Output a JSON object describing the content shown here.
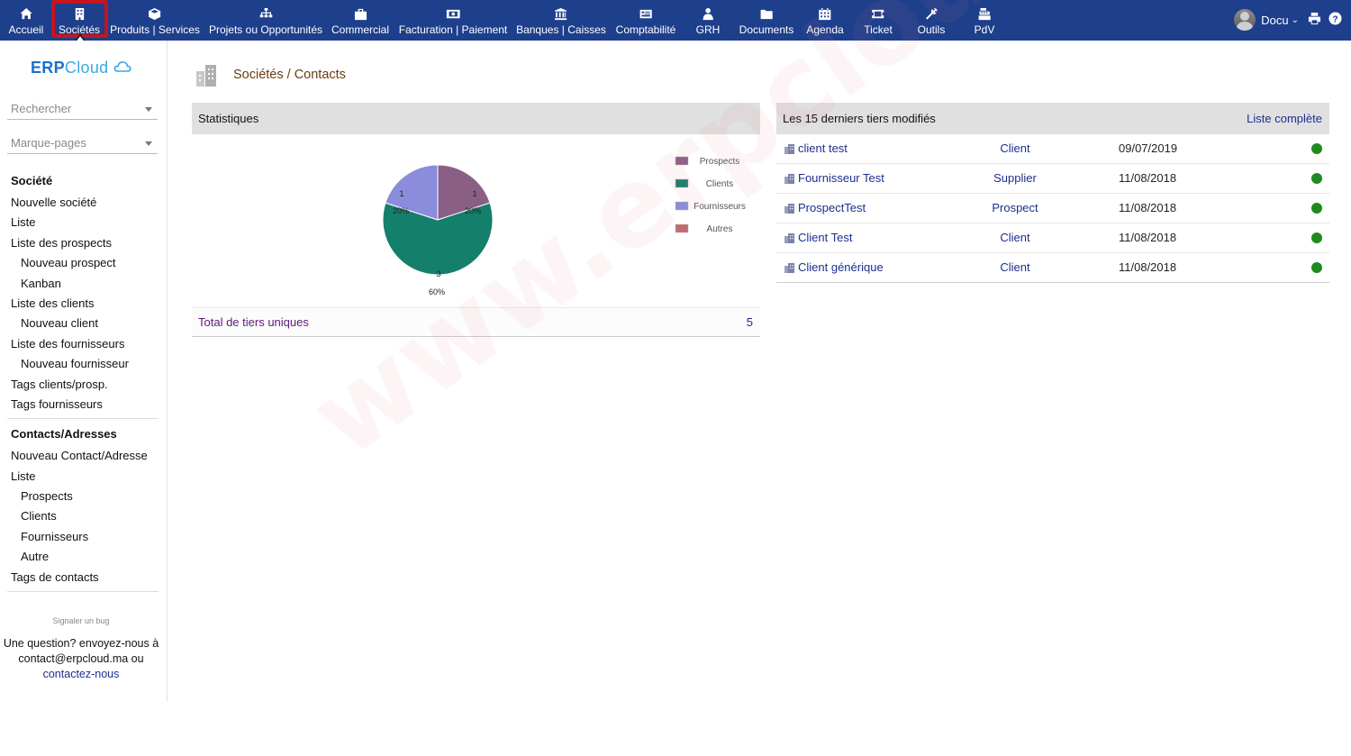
{
  "topnav": {
    "items": [
      {
        "label": "Accueil",
        "icon": "home-icon"
      },
      {
        "label": "Sociétés",
        "icon": "building-icon"
      },
      {
        "label": "Produits | Services",
        "icon": "cube-icon"
      },
      {
        "label": "Projets ou Opportunités",
        "icon": "sitemap-icon"
      },
      {
        "label": "Commercial",
        "icon": "briefcase-icon"
      },
      {
        "label": "Facturation | Paiement",
        "icon": "money-icon"
      },
      {
        "label": "Banques | Caisses",
        "icon": "bank-icon"
      },
      {
        "label": "Comptabilité",
        "icon": "ledger-icon"
      },
      {
        "label": "GRH",
        "icon": "user-tie-icon"
      },
      {
        "label": "Documents",
        "icon": "folder-icon"
      },
      {
        "label": "Agenda",
        "icon": "calendar-icon"
      },
      {
        "label": "Ticket",
        "icon": "ticket-icon"
      },
      {
        "label": "Outils",
        "icon": "wrench-icon"
      },
      {
        "label": "PdV",
        "icon": "cash-register-icon"
      }
    ],
    "user": "Docu",
    "accent": "#1d3f8c",
    "highlight_color": "#c9141b"
  },
  "sidebar": {
    "logo_erp": "ERP",
    "logo_cloud": "Cloud",
    "search_placeholder": "Rechercher",
    "bookmarks_placeholder": "Marque-pages",
    "section1": {
      "title": "Société",
      "items": [
        {
          "label": "Nouvelle société",
          "level": 1
        },
        {
          "label": "Liste",
          "level": 1
        },
        {
          "label": "Liste des prospects",
          "level": 1
        },
        {
          "label": "Nouveau prospect",
          "level": 2
        },
        {
          "label": "Kanban",
          "level": 2
        },
        {
          "label": "Liste des clients",
          "level": 1
        },
        {
          "label": "Nouveau client",
          "level": 2
        },
        {
          "label": "Liste des fournisseurs",
          "level": 1
        },
        {
          "label": "Nouveau fournisseur",
          "level": 2
        },
        {
          "label": "Tags clients/prosp.",
          "level": 1
        },
        {
          "label": "Tags fournisseurs",
          "level": 1
        }
      ]
    },
    "section2": {
      "title": "Contacts/Adresses",
      "items": [
        {
          "label": "Nouveau Contact/Adresse",
          "level": 1
        },
        {
          "label": "Liste",
          "level": 1
        },
        {
          "label": "Prospects",
          "level": 2
        },
        {
          "label": "Clients",
          "level": 2
        },
        {
          "label": "Fournisseurs",
          "level": 2
        },
        {
          "label": "Autre",
          "level": 2
        },
        {
          "label": "Tags de contacts",
          "level": 1
        }
      ]
    },
    "report_bug": "Signaler un bug",
    "help_line1": "Une question? envoyez-nous à",
    "help_line2": "contact@erpcloud.ma ou",
    "help_link": "contactez-nous"
  },
  "main": {
    "title": "Sociétés / Contacts",
    "stats": {
      "header": "Statistiques",
      "total_label": "Total de tiers uniques",
      "total_value": "5"
    },
    "recent": {
      "header": "Les 15 derniers tiers modifiés",
      "link": "Liste complète",
      "rows": [
        {
          "name": "client test",
          "type": "Client",
          "date": "09/07/2019"
        },
        {
          "name": "Fournisseur Test",
          "type": "Supplier",
          "date": "11/08/2018"
        },
        {
          "name": "ProspectTest",
          "type": "Prospect",
          "date": "11/08/2018"
        },
        {
          "name": "Client Test",
          "type": "Client",
          "date": "11/08/2018"
        },
        {
          "name": "Client générique",
          "type": "Client",
          "date": "11/08/2018"
        }
      ],
      "status_color": "#1f8a1f"
    }
  },
  "watermark": "www.erpcloud.ma",
  "chart_data": {
    "type": "pie",
    "legend": [
      "Prospects",
      "Clients",
      "Fournisseurs",
      "Autres"
    ],
    "colors": [
      "#8a5f86",
      "#14806b",
      "#8b8cdc",
      "#c26a6f"
    ],
    "slices": [
      {
        "name": "Prospects",
        "value": 1,
        "percent": "20%"
      },
      {
        "name": "Clients",
        "value": 3,
        "percent": "60%"
      },
      {
        "name": "Fournisseurs",
        "value": 1,
        "percent": "20%"
      }
    ],
    "legend_position": "right"
  }
}
